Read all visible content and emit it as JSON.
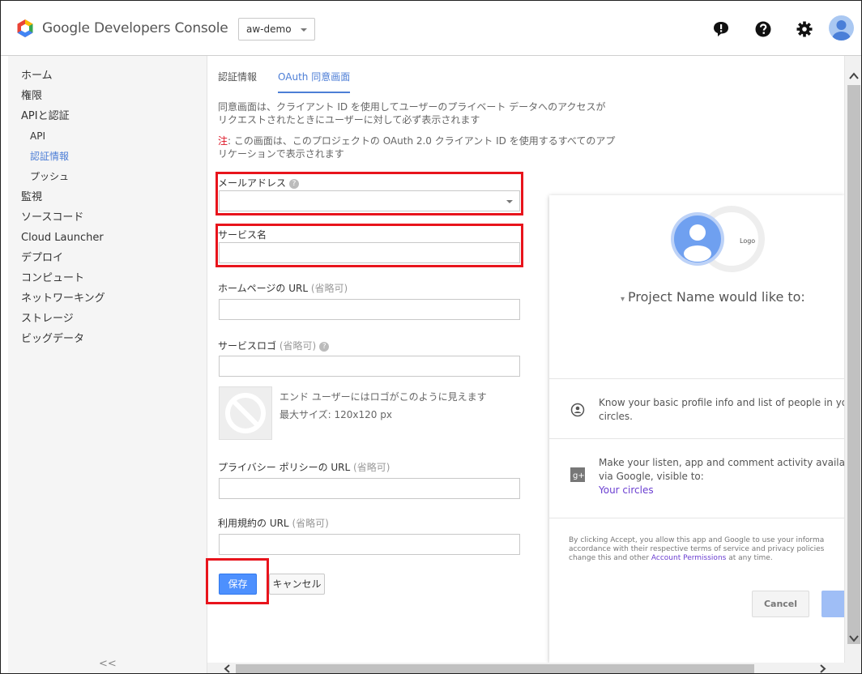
{
  "header": {
    "app_title": "Google Developers Console",
    "project": "aw-demo",
    "icons": [
      "feedback-icon",
      "help-icon",
      "settings-icon",
      "account-avatar"
    ]
  },
  "sidebar": {
    "items": [
      {
        "label": "ホーム"
      },
      {
        "label": "権限"
      },
      {
        "label": "APIと認証"
      },
      {
        "label": "API"
      },
      {
        "label": "認証情報"
      },
      {
        "label": "プッシュ"
      },
      {
        "label": "監視"
      },
      {
        "label": "ソースコード"
      },
      {
        "label": "Cloud Launcher"
      },
      {
        "label": "デプロイ"
      },
      {
        "label": "コンピュート"
      },
      {
        "label": "ネットワーキング"
      },
      {
        "label": "ストレージ"
      },
      {
        "label": "ビッグデータ"
      }
    ],
    "collapse": "<<"
  },
  "tabs": [
    {
      "label": "認証情報"
    },
    {
      "label": "OAuth 同意画面"
    }
  ],
  "content": {
    "description_line1": "同意画面は、クライアント ID を使用してユーザーのプライベート データへのアクセスが",
    "description_line2": "リクエストされたときにユーザーに対して必ず表示されます",
    "note_label": "注",
    "note_line1": ": この画面は、このプロジェクトの OAuth 2.0 クライアント ID を使用するすべてのアプ",
    "note_line2": "リケーションで表示されます"
  },
  "form": {
    "email_label": "メールアドレス",
    "email_value": "",
    "service_name_label": "サービス名",
    "service_name_value": "",
    "homepage_label": "ホームページの URL",
    "homepage_optional": "(省略可)",
    "homepage_value": "",
    "logo_label": "サービスロゴ",
    "logo_optional": "(省略可)",
    "logo_value": "",
    "logo_hint_line1": "エンド ユーザーにはロゴがこのように見えます",
    "logo_hint_line2": "最大サイズ: 120x120 px",
    "privacy_label": "プライバシー ポリシーの URL",
    "privacy_optional": "(省略可)",
    "privacy_value": "",
    "terms_label": "利用規約の URL",
    "terms_optional": "(省略可)",
    "terms_value": "",
    "save_button": "保存",
    "cancel_button": "キャンセル"
  },
  "preview": {
    "logo_text": "Logo",
    "title": "Project Name would like to:",
    "perm1_line1": "Know your basic profile info and list of people in you",
    "perm1_line2": "circles.",
    "perm2_line1": "Make your listen, app and comment activity availabl",
    "perm2_line2": "via Google, visible to:",
    "perm2_link": "Your circles",
    "fine_line1": "By clicking Accept, you allow this app and Google to use your informa",
    "fine_line2": "accordance with their respective terms of service and privacy policies",
    "fine_line3_pre": "change this and other ",
    "fine_link": "Account Permissions",
    "fine_line3_post": " at any time.",
    "cancel_button": "Cancel"
  },
  "colors": {
    "accent": "#4d7ed6",
    "highlight": "#e8141c",
    "primary_button": "#4d90fe",
    "note_red": "#dd1122",
    "link_purple": "#6b3fd1"
  }
}
